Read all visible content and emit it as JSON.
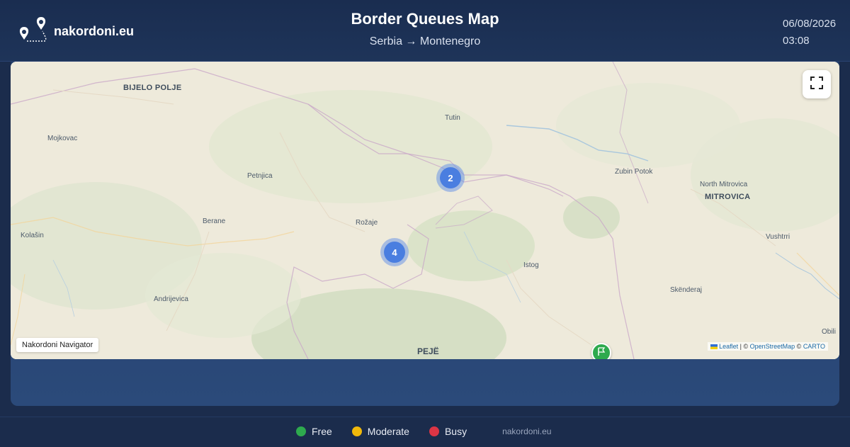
{
  "brand": {
    "name": "nakordoni.eu",
    "logo_icon": "map-pins-icon"
  },
  "header": {
    "title": "Border Queues Map",
    "subtitle": "Serbia → Montenegro"
  },
  "datetime": {
    "date": "06/08/2026",
    "time": "03:08"
  },
  "map": {
    "places": [
      {
        "name": "BIJELO POLJE",
        "kind": "big"
      },
      {
        "name": "Mojkovac",
        "kind": "town"
      },
      {
        "name": "Tutin",
        "kind": "town"
      },
      {
        "name": "Petnjica",
        "kind": "town"
      },
      {
        "name": "Zubin Potok",
        "kind": "town"
      },
      {
        "name": "North Mitrovica",
        "kind": "town"
      },
      {
        "name": "MITROVICA",
        "kind": "big"
      },
      {
        "name": "Berane",
        "kind": "town"
      },
      {
        "name": "Rožaje",
        "kind": "town"
      },
      {
        "name": "Kolašin",
        "kind": "town"
      },
      {
        "name": "Vushtrri",
        "kind": "town"
      },
      {
        "name": "Istog",
        "kind": "town"
      },
      {
        "name": "Skënderaj",
        "kind": "town"
      },
      {
        "name": "Andrijevica",
        "kind": "town"
      },
      {
        "name": "Obili",
        "kind": "town"
      },
      {
        "name": "PEJË",
        "kind": "city"
      }
    ],
    "clusters": [
      {
        "count": "2",
        "status": "moderate"
      },
      {
        "count": "4",
        "status": "moderate"
      }
    ],
    "marker": {
      "icon": "flag-icon",
      "status": "free"
    },
    "fullscreen_icon": "fullscreen-icon",
    "navigator_label": "Nakordoni Navigator",
    "attribution": {
      "leaflet": "Leaflet",
      "separator": " | © ",
      "osm": "OpenStreetMap",
      "copy": " © ",
      "carto": "CARTO"
    }
  },
  "legend": [
    {
      "label": "Free",
      "color": "#2eaa4e"
    },
    {
      "label": "Moderate",
      "color": "#f0b90b"
    },
    {
      "label": "Busy",
      "color": "#dc3545"
    }
  ],
  "footer": {
    "site": "nakordoni.eu"
  }
}
